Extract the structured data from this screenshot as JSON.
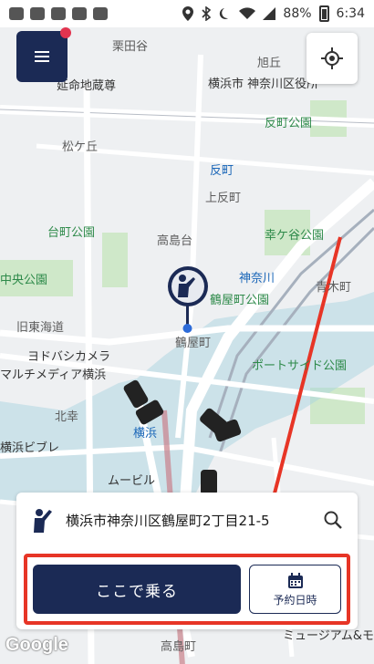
{
  "status_bar": {
    "battery": "88%",
    "time": "6:34",
    "icons": [
      "chat-icon",
      "news-icon",
      "line-icon",
      "image-icon",
      "mail-icon",
      "location-icon",
      "bluetooth-icon",
      "moon-icon",
      "wifi-icon",
      "signal-icon",
      "battery-icon"
    ]
  },
  "map": {
    "labels": [
      {
        "text": "栗田谷",
        "class": "map-label"
      },
      {
        "text": "旭丘",
        "class": "map-label"
      },
      {
        "text": "延命地蔵尊",
        "class": "map-label dark"
      },
      {
        "text": "横浜市 神奈川区役所",
        "class": "map-label dark"
      },
      {
        "text": "反町公園",
        "class": "map-label green"
      },
      {
        "text": "松ケ丘",
        "class": "map-label"
      },
      {
        "text": "反町",
        "class": "map-label blue"
      },
      {
        "text": "上反町",
        "class": "map-label"
      },
      {
        "text": "台町公園",
        "class": "map-label green"
      },
      {
        "text": "幸ケ谷公園",
        "class": "map-label green"
      },
      {
        "text": "高島台",
        "class": "map-label"
      },
      {
        "text": "中央公園",
        "class": "map-label green"
      },
      {
        "text": "神奈川",
        "class": "map-label blue"
      },
      {
        "text": "青木町",
        "class": "map-label"
      },
      {
        "text": "鶴屋町公園",
        "class": "map-label green"
      },
      {
        "text": "旧東海道",
        "class": "map-label"
      },
      {
        "text": "鶴屋町",
        "class": "map-label"
      },
      {
        "text": "ヨドバシカメラ",
        "class": "map-label dark"
      },
      {
        "text": "マルチメディア横浜",
        "class": "map-label dark"
      },
      {
        "text": "ポートサイド公園",
        "class": "map-label green"
      },
      {
        "text": "北幸",
        "class": "map-label"
      },
      {
        "text": "横浜",
        "class": "map-label blue"
      },
      {
        "text": "横浜ビブレ",
        "class": "map-label dark"
      },
      {
        "text": "ムービル",
        "class": "map-label dark"
      },
      {
        "text": "高島町",
        "class": "map-label"
      },
      {
        "text": "ミュージアム&モ",
        "class": "map-label dark"
      }
    ]
  },
  "menu": {
    "icon": "hamburger-icon",
    "badge_color": "#e2344f"
  },
  "locate": {
    "icon": "crosshair-icon"
  },
  "pickup_card": {
    "address": "横浜市神奈川区鶴屋町2丁目21-5",
    "ride_label": "ここで乗る",
    "reserve_label": "予約日時"
  },
  "attribution": "Google",
  "colors": {
    "brand": "#1b2a55",
    "highlight": "#e73526",
    "route": "#ffffff"
  }
}
